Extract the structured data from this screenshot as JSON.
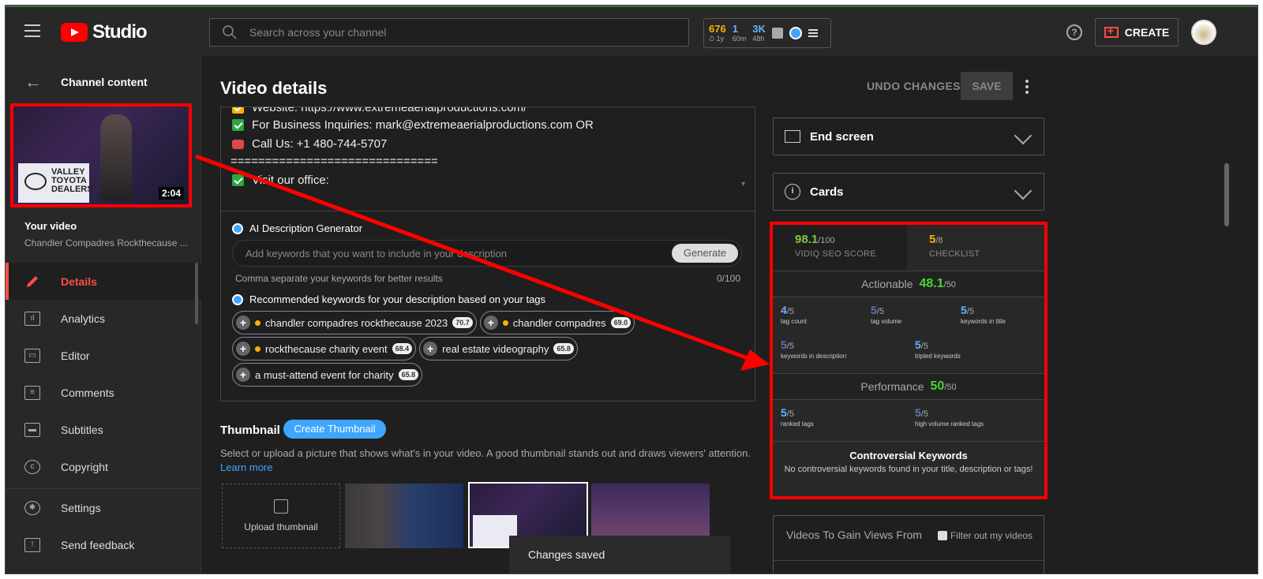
{
  "topbar": {
    "logo_text": "Studio",
    "search_placeholder": "Search across your channel",
    "stats": [
      {
        "value": "676",
        "sub": "⏱ 1y",
        "color": "#f4b400"
      },
      {
        "value": "1",
        "sub": "60m",
        "color": "#6ab0ff"
      },
      {
        "value": "3K",
        "sub": "48h",
        "color": "#6ab0ff"
      }
    ],
    "help_label": "?",
    "create_label": "CREATE"
  },
  "sidebar": {
    "back_label": "Channel content",
    "thumb_sign": "VALLEY TOYOTA DEALERS",
    "thumb_duration": "2:04",
    "your_video_label": "Your video",
    "video_title": "Chandler Compadres Rockthecause ...",
    "nav": [
      {
        "label": "Details",
        "icon": "pencil-icon",
        "active": true
      },
      {
        "label": "Analytics",
        "icon": "analytics-icon"
      },
      {
        "label": "Editor",
        "icon": "editor-icon"
      },
      {
        "label": "Comments",
        "icon": "comments-icon"
      },
      {
        "label": "Subtitles",
        "icon": "subtitles-icon"
      },
      {
        "label": "Copyright",
        "icon": "copyright-icon"
      }
    ],
    "bottom_nav": [
      {
        "label": "Settings",
        "icon": "gear-icon"
      },
      {
        "label": "Send feedback",
        "icon": "feedback-icon"
      }
    ]
  },
  "main": {
    "title": "Video details",
    "undo_label": "UNDO CHANGES",
    "save_label": "SAVE",
    "description_lines": [
      "Website: https://www.extremeaerialproductions.com/",
      "For Business Inquiries: mark@extremeaerialproductions.com OR",
      "Call Us: +1 480-744-5707",
      "==============================",
      "Visit our office:"
    ],
    "ai": {
      "title": "AI Description Generator",
      "placeholder": "Add keywords that you want to include in your description",
      "generate_label": "Generate",
      "hint": "Comma separate your keywords for better results",
      "count": "0/100",
      "rec_title": "Recommended keywords for your description based on your tags",
      "chips": [
        {
          "label": "chandler compadres rockthecause 2023",
          "score": "70.7",
          "dot": true
        },
        {
          "label": "chandler compadres",
          "score": "69.0",
          "dot": true
        },
        {
          "label": "rockthecause charity event",
          "score": "68.4",
          "dot": true
        },
        {
          "label": "real estate videography",
          "score": "65.8",
          "dot": false
        },
        {
          "label": "a must-attend event for charity",
          "score": "65.8",
          "dot": false
        }
      ]
    },
    "thumbnail": {
      "title": "Thumbnail",
      "create_label": "Create Thumbnail",
      "desc": "Select or upload a picture that shows what's in your video. A good thumbnail stands out and draws viewers' attention.",
      "learn_more": "Learn more",
      "upload_label": "Upload thumbnail"
    },
    "toast": "Changes saved"
  },
  "right": {
    "end_screen_label": "End screen",
    "cards_label": "Cards",
    "cards_icon_glyph": "i",
    "seo": {
      "score_value": "98.1",
      "score_max": "/100",
      "score_label": "VIDIQ SEO SCORE",
      "checklist_value": "5",
      "checklist_max": "/8",
      "checklist_label": "CHECKLIST",
      "actionable_label": "Actionable",
      "actionable_value": "48.1",
      "actionable_max": "/50",
      "actionable_metrics": [
        {
          "value": "4",
          "max": "/5",
          "label": "tag count"
        },
        {
          "value": "5",
          "max": "/5",
          "label": "tag volume"
        },
        {
          "value": "5",
          "max": "/5",
          "label": "keywords in title"
        },
        {
          "value": "5",
          "max": "/5",
          "label": "keywords in description"
        },
        {
          "value": "5",
          "max": "/5",
          "label": "tripled keywords"
        }
      ],
      "performance_label": "Performance",
      "performance_value": "50",
      "performance_max": "/50",
      "performance_metrics": [
        {
          "value": "5",
          "max": "/5",
          "label": "ranked tags"
        },
        {
          "value": "5",
          "max": "/5",
          "label": "high volume ranked tags"
        }
      ],
      "controversial_title": "Controversial Keywords",
      "controversial_desc": "No controversial keywords found in your title, description or tags!"
    },
    "videos": {
      "title": "Videos To Gain Views From",
      "filter_label": "Filter out my videos"
    }
  },
  "colors": {
    "accent_red": "#ff0000",
    "active_red": "#ff4e45",
    "vidiq_blue": "#3ea6ff",
    "score_green": "#7ac943",
    "checklist_yellow": "#f4b400"
  }
}
